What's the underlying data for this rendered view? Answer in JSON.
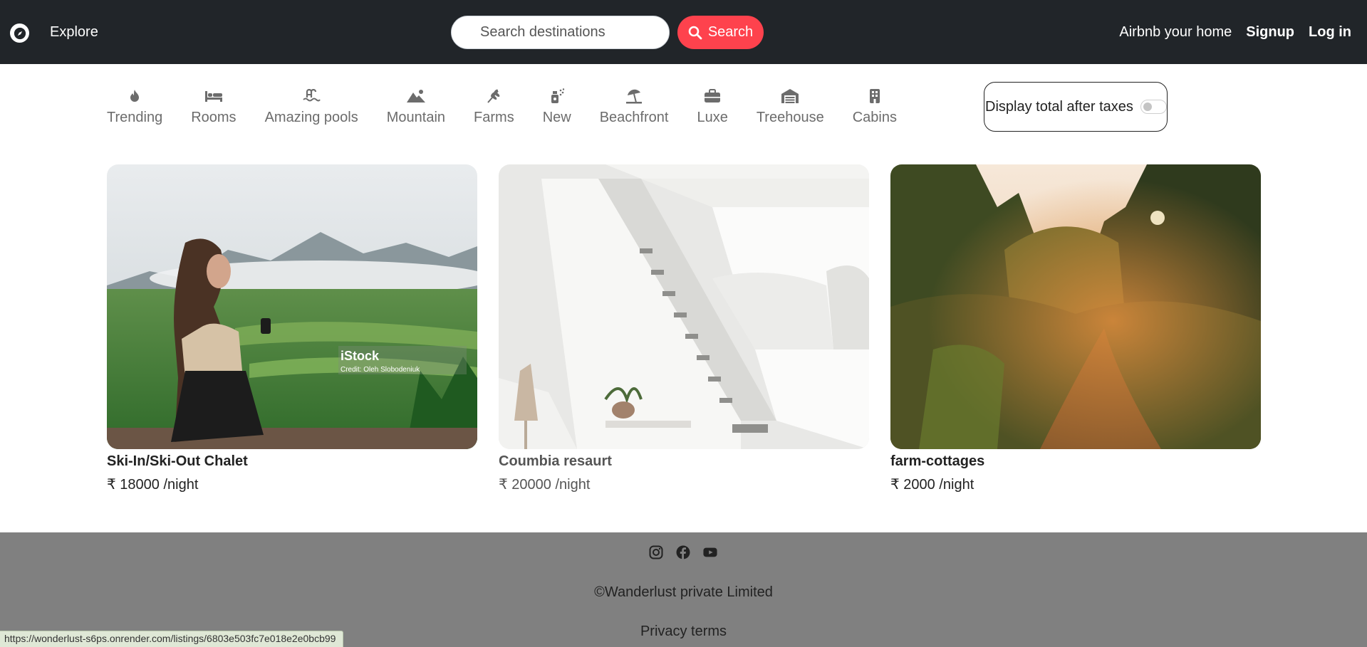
{
  "navbar": {
    "brand_icon": "compass-icon",
    "explore": "Explore",
    "search": {
      "placeholder": "Search destinations",
      "button_label": "Search",
      "button_color": "#fe424d"
    },
    "links": {
      "host": "Airbnb your home",
      "signup": "Signup",
      "login": "Log in"
    }
  },
  "filters": [
    {
      "label": "Trending",
      "icon": "fire-icon"
    },
    {
      "label": "Rooms",
      "icon": "bed-icon"
    },
    {
      "label": "Amazing pools",
      "icon": "pool-icon"
    },
    {
      "label": "Mountain",
      "icon": "mountain-icon"
    },
    {
      "label": "Farms",
      "icon": "wheat-icon"
    },
    {
      "label": "New",
      "icon": "spray-icon"
    },
    {
      "label": "Beachfront",
      "icon": "umbrella-beach-icon"
    },
    {
      "label": "Luxe",
      "icon": "briefcase-icon"
    },
    {
      "label": "Treehouse",
      "icon": "warehouse-icon"
    },
    {
      "label": "Cabins",
      "icon": "building-icon"
    }
  ],
  "tax_toggle": {
    "label": "Display total after taxes",
    "enabled": false
  },
  "listings": [
    {
      "title": "Ski-In/Ski-Out Chalet",
      "price": "₹ 18000 /night",
      "watermark": "iStock",
      "watermark_credit": "Credit: Oleh Slobodeniuk"
    },
    {
      "title": "Coumbia resaurt",
      "price": "₹ 20000 /night"
    },
    {
      "title": "farm-cottages",
      "price": "₹ 2000 /night"
    }
  ],
  "footer": {
    "social_icons": [
      "instagram-icon",
      "facebook-icon",
      "youtube-icon"
    ],
    "copyright": "©Wanderlust private Limited",
    "privacy": "Privacy terms"
  },
  "status_bar": {
    "url": "https://wonderlust-s6ps.onrender.com/listings/6803e503fc7e018e2e0bcb99"
  }
}
